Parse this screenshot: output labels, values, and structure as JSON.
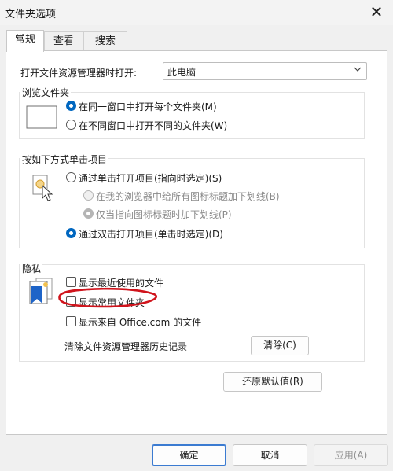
{
  "window": {
    "title": "文件夹选项",
    "close_glyph": "✕"
  },
  "tabs": [
    {
      "label": "常规",
      "active": true
    },
    {
      "label": "查看",
      "active": false
    },
    {
      "label": "搜索",
      "active": false
    }
  ],
  "open_with": {
    "label": "打开文件资源管理器时打开:",
    "selected": "此电脑"
  },
  "browse_folders": {
    "legend": "浏览文件夹",
    "options": [
      {
        "label": "在同一窗口中打开每个文件夹(M)",
        "checked": true
      },
      {
        "label": "在不同窗口中打开不同的文件夹(W)",
        "checked": false
      }
    ]
  },
  "click_items": {
    "legend": "按如下方式单击项目",
    "single_click": {
      "label": "通过单击打开项目(指向时选定)(S)",
      "checked": false
    },
    "underline_all": {
      "label": "在我的浏览器中给所有图标标题加下划线(B)",
      "checked": false,
      "disabled": true
    },
    "underline_point": {
      "label": "仅当指向图标标题时加下划线(P)",
      "checked": true,
      "disabled": true
    },
    "double_click": {
      "label": "通过双击打开项目(单击时选定)(D)",
      "checked": true
    }
  },
  "privacy": {
    "legend": "隐私",
    "show_recent": {
      "label": "显示最近使用的文件",
      "checked": false
    },
    "show_frequent": {
      "label": "显示常用文件夹",
      "checked": false
    },
    "show_office": {
      "label": "显示来自 Office.com 的文件",
      "checked": false
    },
    "clear_history_label": "清除文件资源管理器历史记录",
    "clear_button": "清除(C)"
  },
  "restore_defaults": "还原默认值(R)",
  "footer": {
    "ok": "确定",
    "cancel": "取消",
    "apply": "应用(A)"
  },
  "colors": {
    "accent": "#0067c0",
    "annotation": "#d0141c"
  }
}
